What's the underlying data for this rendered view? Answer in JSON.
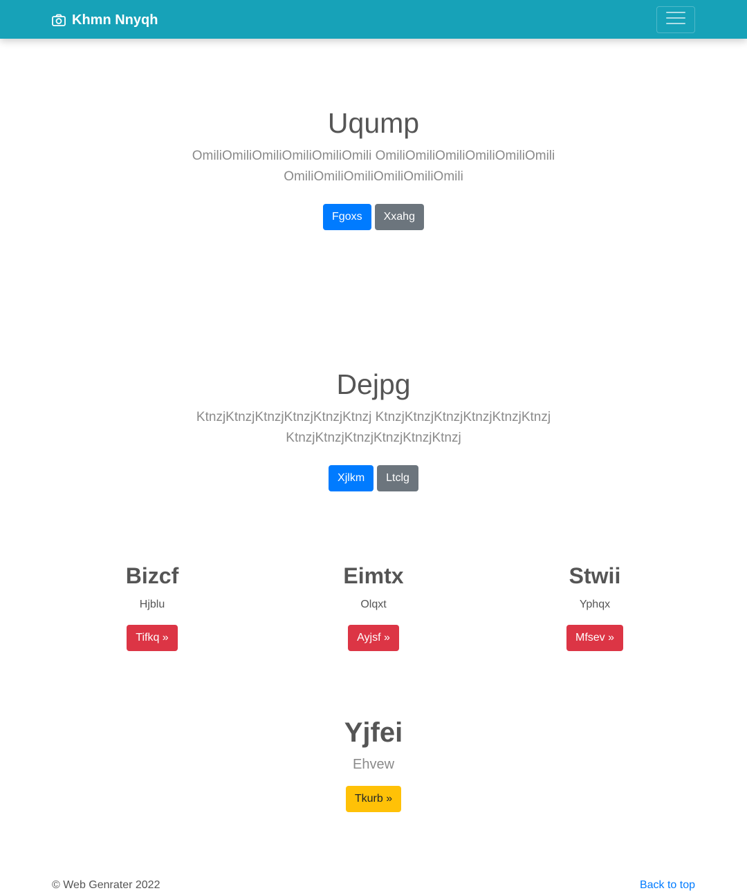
{
  "navbar": {
    "brand_icon": "camera-icon",
    "brand": "Khmn Nnyqh",
    "toggler_icon": "hamburger-menu-icon",
    "background": "#17a2b8"
  },
  "hero1": {
    "title": "Uqump",
    "text": "OmiliOmiliOmiliOmiliOmiliOmili OmiliOmiliOmiliOmiliOmiliOmili OmiliOmiliOmiliOmiliOmiliOmili",
    "primary_button": "Fgoxs",
    "secondary_button": "Xxahg"
  },
  "hero2": {
    "title": "Dejpg",
    "text": "KtnzjKtnzjKtnzjKtnzjKtnzjKtnzj KtnzjKtnzjKtnzjKtnzjKtnzjKtnzj KtnzjKtnzjKtnzjKtnzjKtnzjKtnzj",
    "primary_button": "Xjlkm",
    "secondary_button": "Ltclg"
  },
  "columns": [
    {
      "title": "Bizcf",
      "text": "Hjblu",
      "button": "Tifkq »"
    },
    {
      "title": "Eimtx",
      "text": "Olqxt",
      "button": "Ayjsf »"
    },
    {
      "title": "Stwii",
      "text": "Yphqx",
      "button": "Mfsev »"
    }
  ],
  "feature": {
    "title": "Yjfei",
    "text": "Ehvew",
    "button": "Tkurb »"
  },
  "footer": {
    "copyright": "© Web Genrater 2022",
    "back_to_top": "Back to top"
  },
  "colors": {
    "primary": "#007bff",
    "secondary": "#6c757d",
    "danger": "#dc3545",
    "warning": "#ffc107"
  }
}
